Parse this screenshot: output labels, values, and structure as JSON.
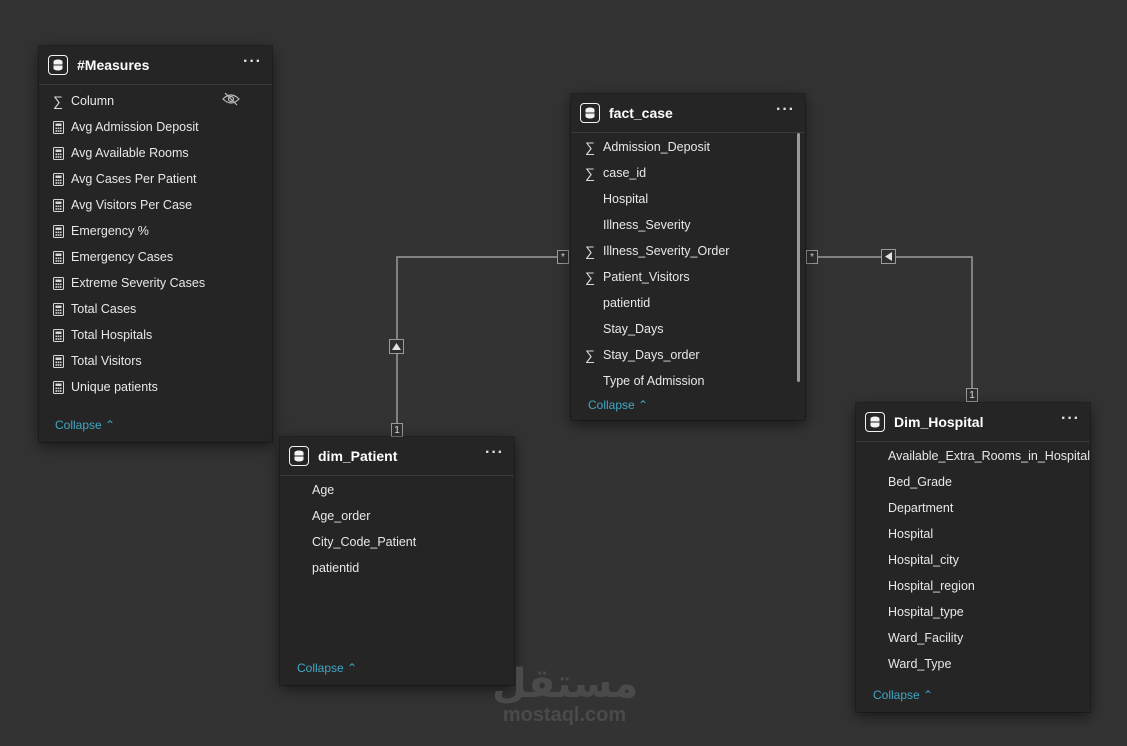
{
  "tables": {
    "measures": {
      "title": "#Measures",
      "more_label": "···",
      "collapse_label": "Collapse",
      "fields": [
        {
          "name": "Column",
          "icon": "sigma-icon"
        },
        {
          "name": "Avg Admission Deposit",
          "icon": "calculator-icon"
        },
        {
          "name": "Avg Available Rooms",
          "icon": "calculator-icon"
        },
        {
          "name": "Avg Cases Per Patient",
          "icon": "calculator-icon"
        },
        {
          "name": "Avg Visitors Per Case",
          "icon": "calculator-icon"
        },
        {
          "name": "Emergency %",
          "icon": "calculator-icon"
        },
        {
          "name": "Emergency Cases",
          "icon": "calculator-icon"
        },
        {
          "name": "Extreme Severity Cases",
          "icon": "calculator-icon"
        },
        {
          "name": "Total Cases",
          "icon": "calculator-icon"
        },
        {
          "name": "Total Hospitals",
          "icon": "calculator-icon"
        },
        {
          "name": "Total Visitors",
          "icon": "calculator-icon"
        },
        {
          "name": "Unique patients",
          "icon": "calculator-icon"
        }
      ]
    },
    "fact_case": {
      "title": "fact_case",
      "more_label": "···",
      "collapse_label": "Collapse",
      "fields": [
        {
          "name": "Admission_Deposit",
          "icon": "sigma-icon"
        },
        {
          "name": "case_id",
          "icon": "sigma-icon"
        },
        {
          "name": "Hospital",
          "icon": "none"
        },
        {
          "name": "Illness_Severity",
          "icon": "none"
        },
        {
          "name": "Illness_Severity_Order",
          "icon": "sigma-icon"
        },
        {
          "name": "Patient_Visitors",
          "icon": "sigma-icon"
        },
        {
          "name": "patientid",
          "icon": "none"
        },
        {
          "name": "Stay_Days",
          "icon": "none"
        },
        {
          "name": "Stay_Days_order",
          "icon": "sigma-icon"
        },
        {
          "name": "Type of Admission",
          "icon": "none"
        }
      ]
    },
    "dim_patient": {
      "title": "dim_Patient",
      "more_label": "···",
      "collapse_label": "Collapse",
      "fields": [
        {
          "name": "Age",
          "icon": "none"
        },
        {
          "name": "Age_order",
          "icon": "none"
        },
        {
          "name": "City_Code_Patient",
          "icon": "none"
        },
        {
          "name": "patientid",
          "icon": "none"
        }
      ]
    },
    "dim_hospital": {
      "title": "Dim_Hospital",
      "more_label": "···",
      "collapse_label": "Collapse",
      "fields": [
        {
          "name": "Available_Extra_Rooms_in_Hospital",
          "icon": "none"
        },
        {
          "name": "Bed_Grade",
          "icon": "none"
        },
        {
          "name": "Department",
          "icon": "none"
        },
        {
          "name": "Hospital",
          "icon": "none"
        },
        {
          "name": "Hospital_city",
          "icon": "none"
        },
        {
          "name": "Hospital_region",
          "icon": "none"
        },
        {
          "name": "Hospital_type",
          "icon": "none"
        },
        {
          "name": "Ward_Facility",
          "icon": "none"
        },
        {
          "name": "Ward_Type",
          "icon": "none"
        }
      ]
    }
  },
  "relationships": [
    {
      "from": "fact_case",
      "to": "dim_Patient",
      "many_label": "*",
      "one_label": "1"
    },
    {
      "from": "fact_case",
      "to": "Dim_Hospital",
      "many_label": "*",
      "one_label": "1"
    }
  ],
  "watermark": {
    "arabic": "مستقل",
    "latin": "mostaql.com"
  },
  "colors": {
    "canvas": "#333333",
    "card": "#252525",
    "link": "#3fa8c4",
    "line": "#9a9a9a"
  }
}
